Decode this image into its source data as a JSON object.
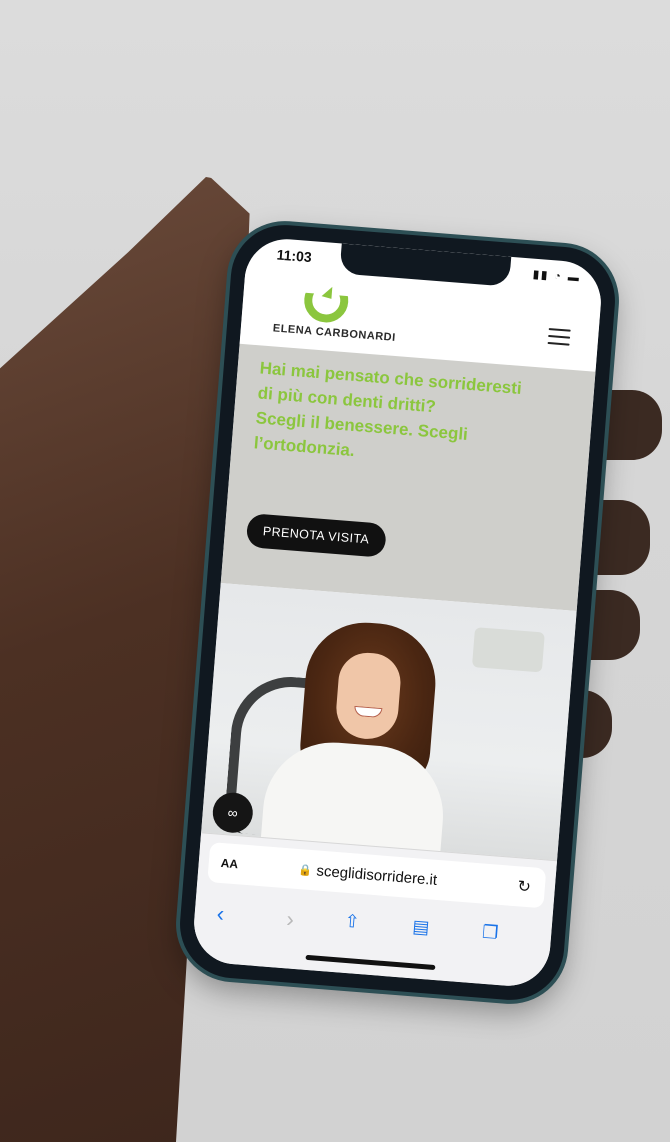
{
  "status_bar": {
    "time": "11:03"
  },
  "brand": {
    "name": "ELENA CARBONARDI",
    "accent_color": "#8bc63e"
  },
  "hero": {
    "headline_lines": [
      "Hai mai pensato che sorrideresti",
      "di più con denti dritti?",
      "Scegli il benessere. Scegli",
      "l’ortodonzia."
    ],
    "cta_label": "PRENOTA VISITA"
  },
  "browser": {
    "text_size_label": "AA",
    "url": "sceglidisorridere.it",
    "icons": [
      "back-icon",
      "forward-icon",
      "share-icon",
      "bookmarks-icon",
      "tabs-icon",
      "reload-icon",
      "lock-icon"
    ]
  }
}
